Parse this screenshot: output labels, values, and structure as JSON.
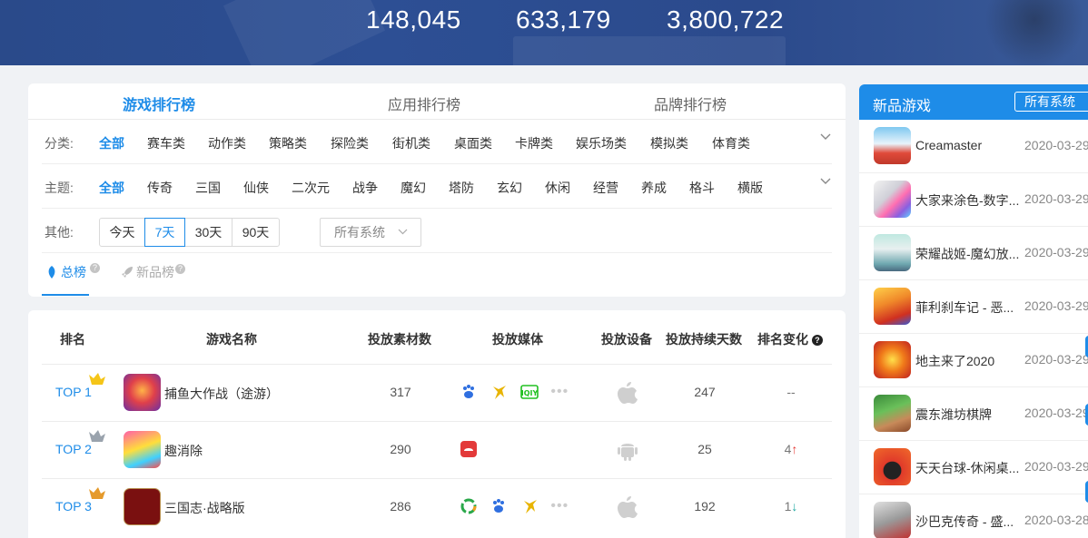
{
  "banner": {
    "stats": [
      "148,045",
      "633,179",
      "3,800,722"
    ]
  },
  "tabs": [
    "游戏排行榜",
    "应用排行榜",
    "品牌排行榜"
  ],
  "filters": {
    "category_label": "分类:",
    "categories": [
      "全部",
      "赛车类",
      "动作类",
      "策略类",
      "探险类",
      "街机类",
      "桌面类",
      "卡牌类",
      "娱乐场类",
      "模拟类",
      "体育类"
    ],
    "theme_label": "主题:",
    "themes": [
      "全部",
      "传奇",
      "三国",
      "仙侠",
      "二次元",
      "战争",
      "魔幻",
      "塔防",
      "玄幻",
      "休闲",
      "经营",
      "养成",
      "格斗",
      "横版"
    ],
    "other_label": "其他:",
    "periods": [
      "今天",
      "7天",
      "30天",
      "90天"
    ],
    "system_select": "所有系统"
  },
  "subtabs": {
    "total": "总榜",
    "new": "新品榜"
  },
  "table": {
    "headers": [
      "排名",
      "游戏名称",
      "投放素材数",
      "投放媒体",
      "投放设备",
      "投放持续天数",
      "排名变化"
    ],
    "help_icon": "?",
    "rows": [
      {
        "rank": "TOP 1",
        "name": "捕鱼大作战（途游）",
        "materials": "317",
        "days": "247",
        "change": "--",
        "arrow": ""
      },
      {
        "rank": "TOP 2",
        "name": "趣消除",
        "materials": "290",
        "days": "25",
        "change": "4",
        "arrow": "↑"
      },
      {
        "rank": "TOP 3",
        "name": "三国志·战略版",
        "materials": "286",
        "days": "192",
        "change": "1",
        "arrow": "↓"
      }
    ]
  },
  "new_games": {
    "title": "新品游戏",
    "system_select": "所有系统",
    "items": [
      {
        "name": "Creamaster",
        "date": "2020-03-29"
      },
      {
        "name": "大家来涂色-数字...",
        "date": "2020-03-29"
      },
      {
        "name": "荣耀战姬-魔幻放...",
        "date": "2020-03-29"
      },
      {
        "name": "菲利刹车记 - 恶...",
        "date": "2020-03-29"
      },
      {
        "name": "地主来了2020",
        "date": "2020-03-29"
      },
      {
        "name": "震东潍坊棋牌",
        "date": "2020-03-29"
      },
      {
        "name": "天天台球-休闲桌...",
        "date": "2020-03-29"
      },
      {
        "name": "沙巴克传奇 - 盛...",
        "date": "2020-03-28"
      }
    ]
  },
  "colors": {
    "accent": "#1e8ce8",
    "banner": "#2d4f94",
    "up": "#e53935",
    "down": "#1aa7a0"
  }
}
